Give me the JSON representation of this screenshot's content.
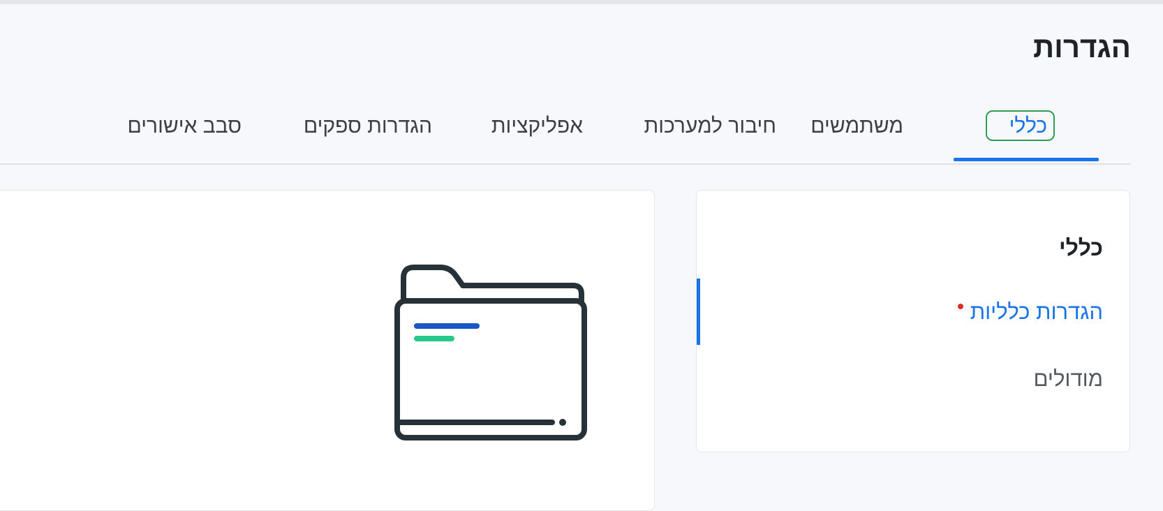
{
  "header": {
    "title": "הגדרות"
  },
  "tabs": [
    {
      "label": "כללי",
      "active": true
    },
    {
      "label": "משתמשים"
    },
    {
      "label": "חיבור למערכות"
    },
    {
      "label": "אפליקציות"
    },
    {
      "label": "הגדרות ספקים"
    },
    {
      "label": "סבב אישורים"
    }
  ],
  "sidebar": {
    "heading": "כללי",
    "items": [
      {
        "label": "הגדרות כלליות",
        "active": true,
        "has_dot": true
      },
      {
        "label": "מודולים"
      }
    ]
  },
  "main": {
    "illustration": "folder-icon"
  },
  "colors": {
    "accent": "#1a73e8",
    "active_outline": "#2e9e52",
    "dot": "#d93025",
    "folder_stroke": "#263238",
    "folder_line_blue": "#1a56c4",
    "folder_line_green": "#26c98a"
  }
}
